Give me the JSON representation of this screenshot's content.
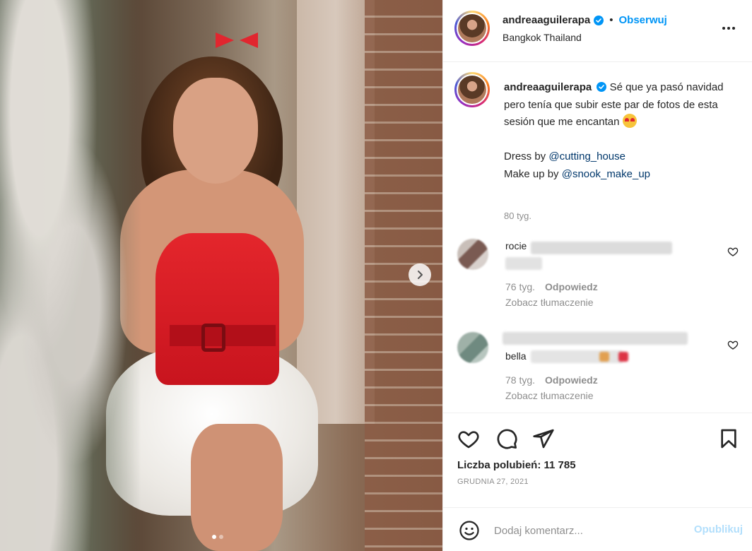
{
  "post": {
    "image_alt": "",
    "carousel_dots": 2,
    "active_dot": 0
  },
  "header": {
    "username": "andreaaguilerapa",
    "separator": "•",
    "follow_label": "Obserwuj",
    "location": "Bangkok Thailand",
    "more_icon": "more-options-icon"
  },
  "caption": {
    "username": "andreaaguilerapa",
    "text_part1": "Sé que ya pasó navidad pero tenía que subir este par de fotos de esta sesión que me encantan",
    "dress_prefix": "Dress by ",
    "dress_mention": "@cutting_house",
    "makeup_prefix": "Make up by ",
    "makeup_mention": "@snook_make_up",
    "time": "80 tyg."
  },
  "comments": [
    {
      "username_partial": "rocie",
      "text_partial": "",
      "time": "76 tyg.",
      "reply_label": "Odpowiedz",
      "translate_label": "Zobacz tłumaczenie"
    },
    {
      "username_partial": "",
      "text_partial": "bella",
      "time": "78 tyg.",
      "reply_label": "Odpowiedz",
      "translate_label": "Zobacz tłumaczenie"
    }
  ],
  "actions": {
    "likes_label": "Liczba polubień: 11 785",
    "date": "GRUDNIA 27, 2021"
  },
  "add_comment": {
    "placeholder": "Dodaj komentarz...",
    "post_label": "Opublikuj"
  },
  "colors": {
    "link_blue": "#0095f6",
    "mention_navy": "#00376b",
    "muted_gray": "#8e8e8e",
    "post_disabled": "#b2dffc"
  }
}
